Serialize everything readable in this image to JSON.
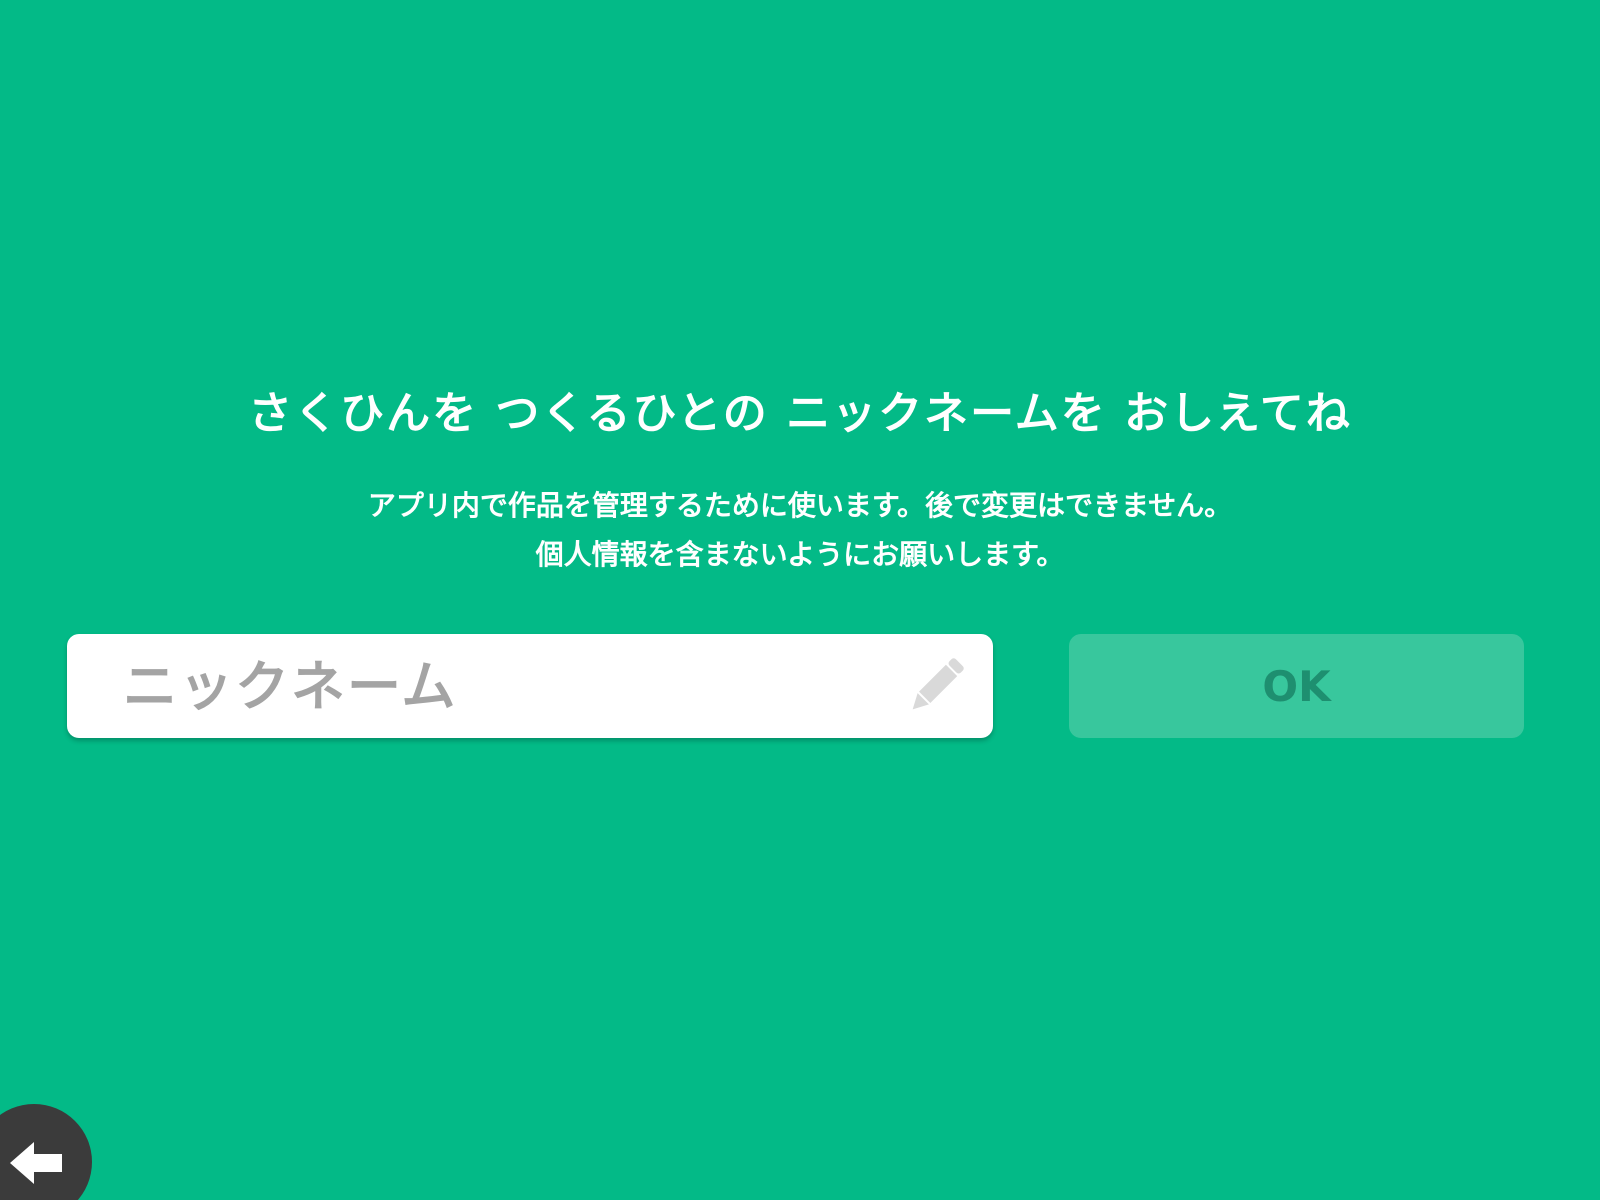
{
  "title": "さくひんを つくるひとの ニックネームを おしえてね",
  "description": {
    "line1": "アプリ内で作品を管理するために使います。後で変更はできません。",
    "line2": "個人情報を含まないようにお願いします。"
  },
  "nickname_input": {
    "value": "",
    "placeholder": "ニックネーム",
    "icon": "pencil-icon"
  },
  "ok_button": {
    "label": "OK",
    "state": "disabled"
  },
  "back_button": {
    "icon": "arrow-left-icon"
  },
  "colors": {
    "background": "#03BA87",
    "ok_button_bg": "#38C79D",
    "ok_button_text": "#1E8F70",
    "back_button_bg": "#3B3B3B"
  }
}
